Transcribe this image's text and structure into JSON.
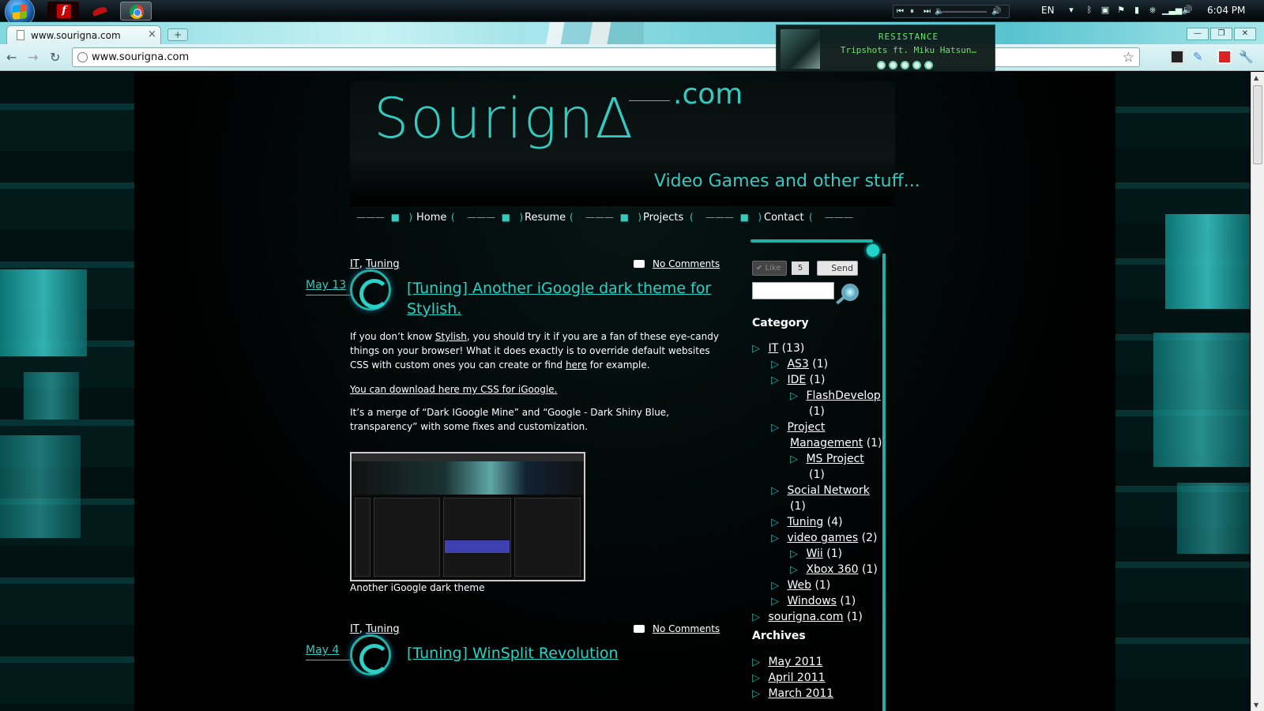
{
  "taskbar": {
    "lang": "EN",
    "clock": "6:04 PM"
  },
  "browser": {
    "tab_title": "www.sourigna.com",
    "tab_close": "×",
    "new_tab": "+",
    "url": "www.sourigna.com",
    "window_buttons": [
      "—",
      "❐",
      "✕"
    ]
  },
  "now_playing": {
    "status": "RESISTANCE",
    "track": "Tripshots ft. Miku Hatsun…",
    "rating": 5
  },
  "site": {
    "logo": "Sourign",
    "logo_end": "∆",
    "logo_com": ".com",
    "tagline": "Video Games and other stuff..."
  },
  "menu": [
    "Home",
    "Resume",
    "Projects",
    "Contact"
  ],
  "posts": [
    {
      "cat1": "IT",
      "cat2": "Tuning",
      "comments": "No Comments",
      "date": "May 13",
      "title": "[Tuning] Another iGoogle dark theme for Stylish.",
      "p1_a": "If you don’t know ",
      "p1_link": "Stylish",
      "p1_b": ", you should try it if you are a fan of these eye-candy things on your browser! What it does exactly is to override default websites CSS with custom ones you can create or find ",
      "p1_link2": "here",
      "p1_c": " for example.",
      "p2_link": "You can download here my CSS for iGoogle.",
      "p3": "It’s a merge of “Dark IGoogle Mine” and “Google - Dark Shiny Blue, transparency” with some fixes and customization.",
      "image_caption": "Another iGoogle dark theme"
    },
    {
      "cat1": "IT",
      "cat2": "Tuning",
      "comments": "No Comments",
      "date": "May 4",
      "title": "[Tuning] WinSplit Revolution"
    }
  ],
  "sidebar": {
    "like": "✔ Like",
    "like_count": "5",
    "send": "Send",
    "category_heading": "Category",
    "categories": [
      {
        "label": "IT",
        "count": "(13)"
      },
      {
        "label": "AS3",
        "count": "(1)"
      },
      {
        "label": "IDE",
        "count": "(1)"
      },
      {
        "label": "FlashDevelop",
        "count": "(1)"
      },
      {
        "label": "Project",
        "label2": "Management",
        "count": "(1)"
      },
      {
        "label": "MS Project",
        "count": "(1)"
      },
      {
        "label": "Social Network",
        "count": "(1)"
      },
      {
        "label": "Tuning",
        "count": "(4)"
      },
      {
        "label": "video games",
        "count": "(2)"
      },
      {
        "label": "Wii",
        "count": "(1)"
      },
      {
        "label": "Xbox 360",
        "count": "(1)"
      },
      {
        "label": "Web",
        "count": "(1)"
      },
      {
        "label": "Windows",
        "count": "(1)"
      },
      {
        "label": "sourigna.com",
        "count": "(1)"
      }
    ],
    "archives_heading": "Archives",
    "archives": [
      "May 2011",
      "April 2011",
      "March 2011"
    ]
  }
}
